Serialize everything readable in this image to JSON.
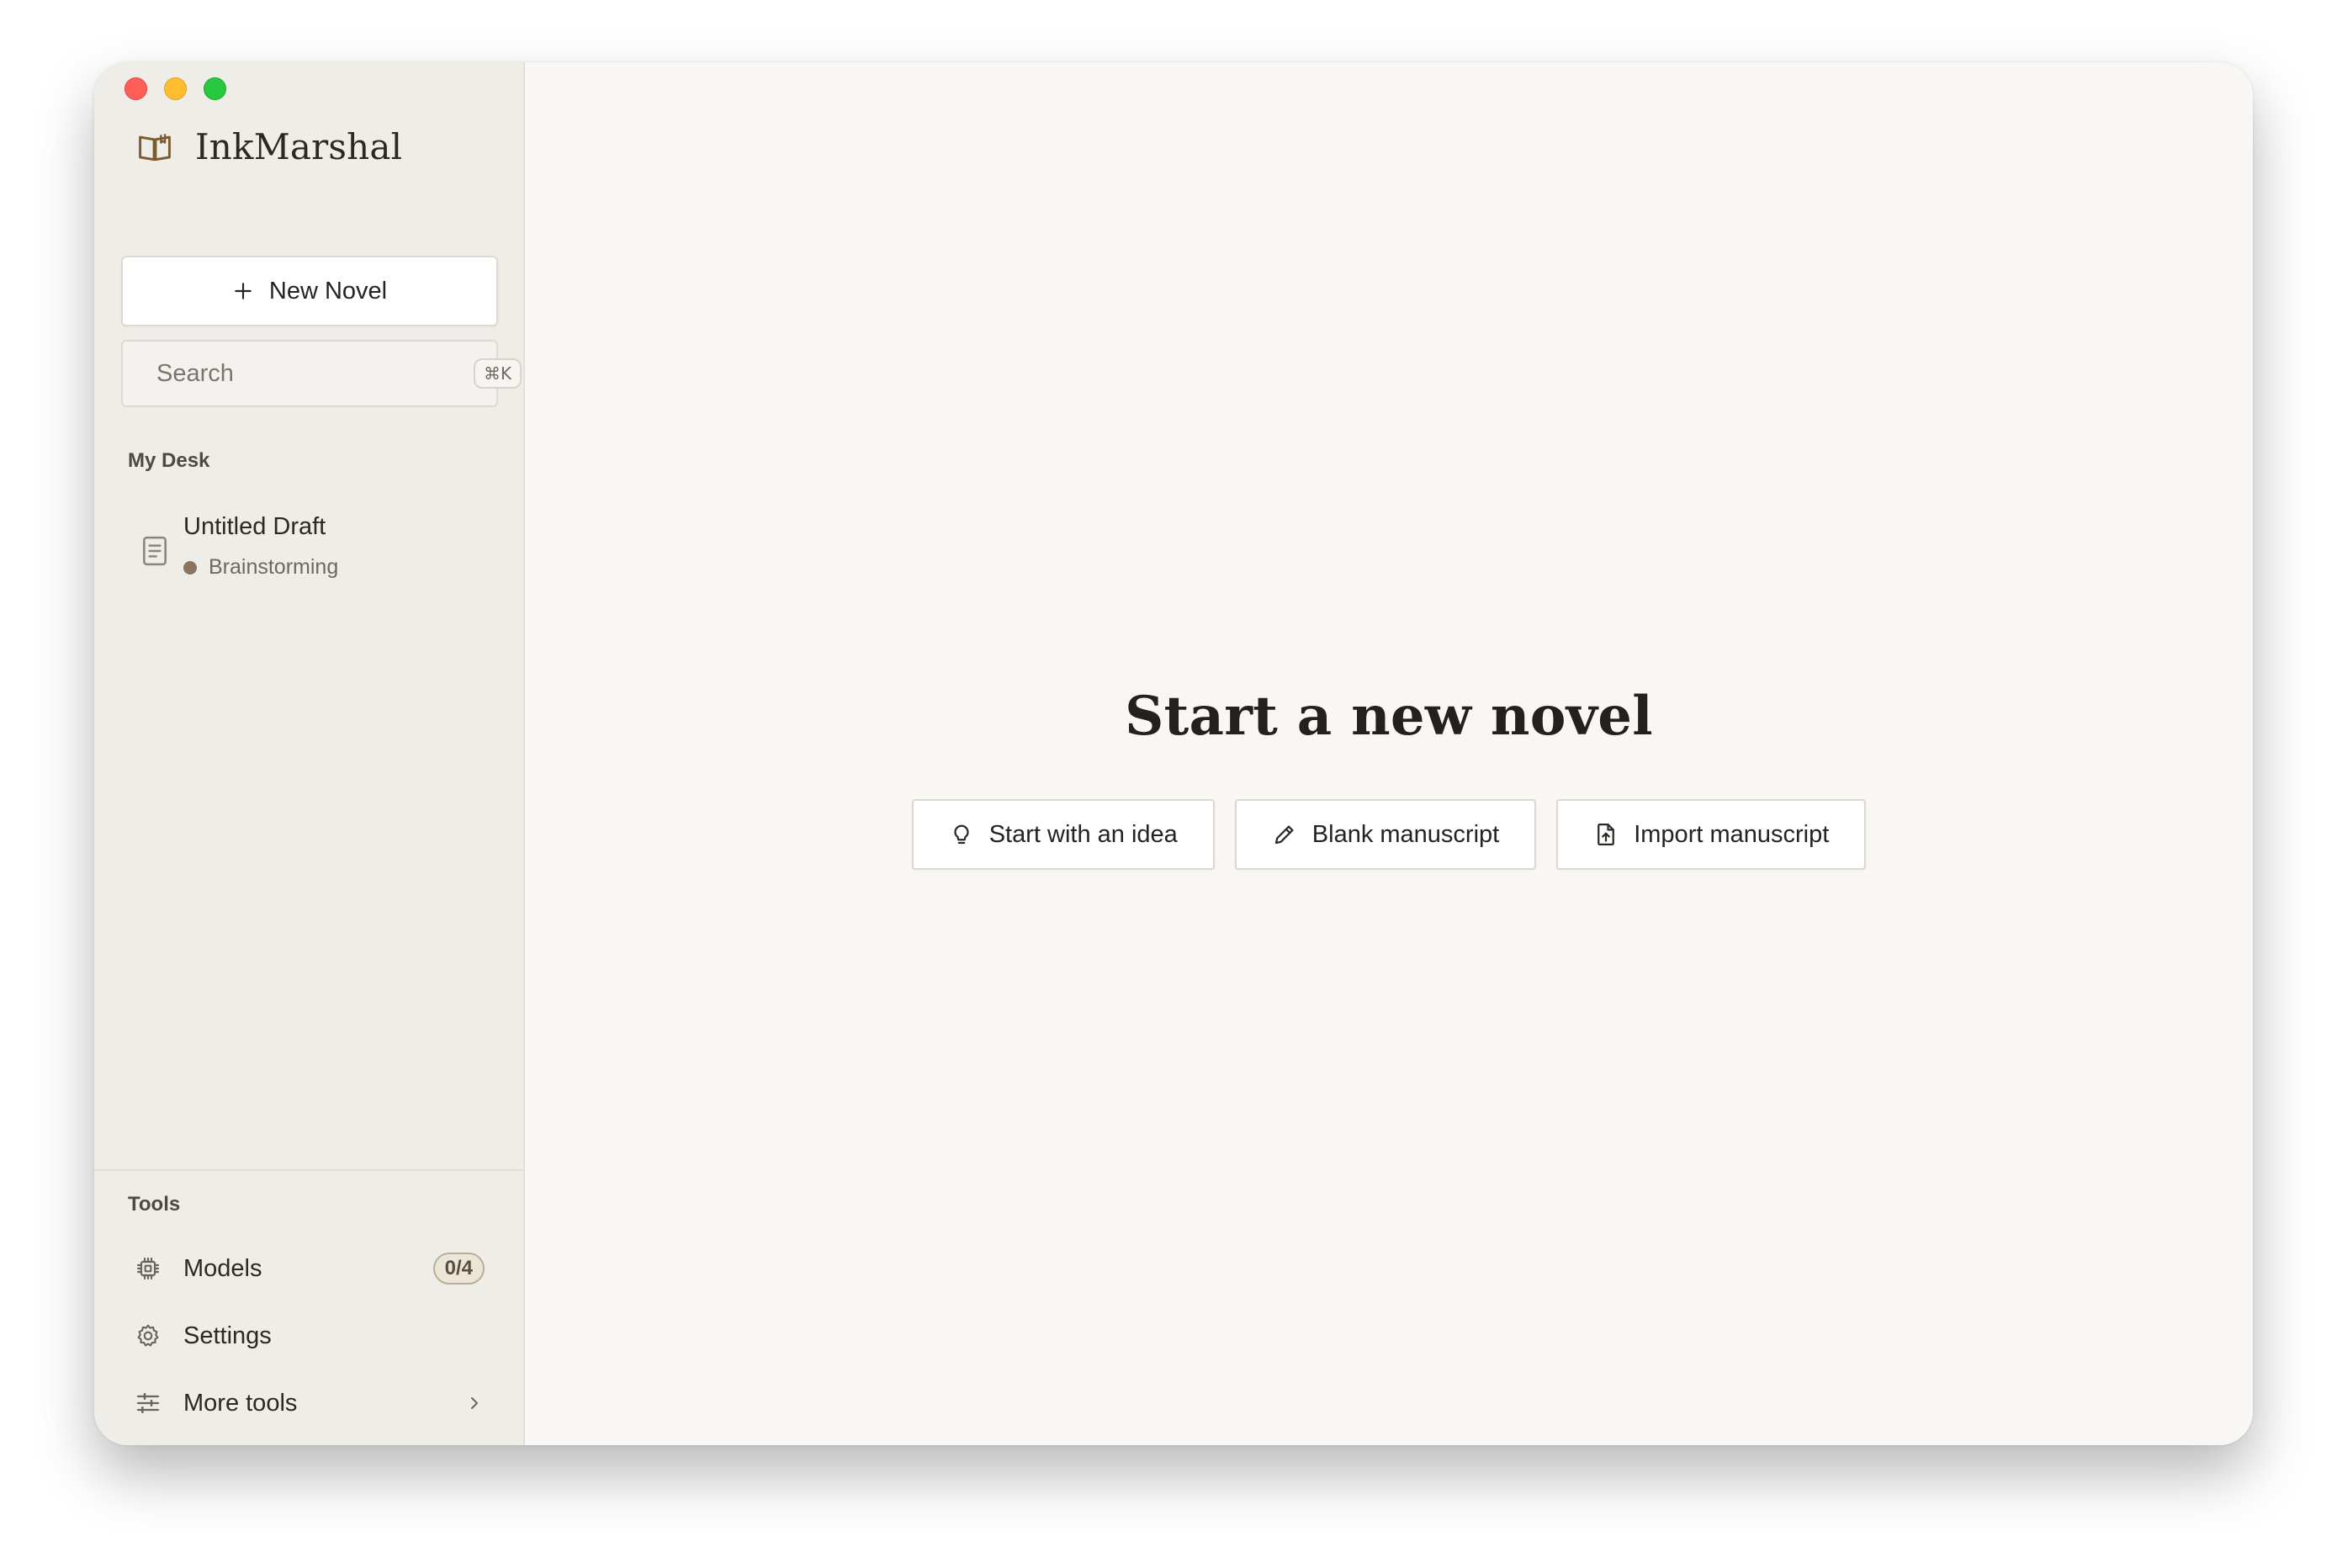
{
  "app": {
    "name": "InkMarshal"
  },
  "sidebar": {
    "new_novel_label": "New Novel",
    "search": {
      "placeholder": "Search",
      "shortcut": "⌘K"
    },
    "desk": {
      "heading": "My Desk",
      "items": [
        {
          "title": "Untitled Draft",
          "status": "Brainstorming",
          "status_color": "#8b7560"
        }
      ]
    },
    "tools": {
      "heading": "Tools",
      "items": [
        {
          "label": "Models",
          "icon": "chip-icon",
          "badge": "0/4"
        },
        {
          "label": "Settings",
          "icon": "gear-icon"
        },
        {
          "label": "More tools",
          "icon": "sliders-icon"
        }
      ]
    }
  },
  "main": {
    "title": "Start a new novel",
    "actions": [
      {
        "label": "Start with an idea",
        "icon": "lightbulb-icon"
      },
      {
        "label": "Blank manuscript",
        "icon": "pencil-icon"
      },
      {
        "label": "Import manuscript",
        "icon": "file-import-icon"
      }
    ]
  },
  "colors": {
    "sidebar_bg": "#efede8",
    "main_bg": "#f9f7f3",
    "accent_brown": "#8b7560"
  }
}
